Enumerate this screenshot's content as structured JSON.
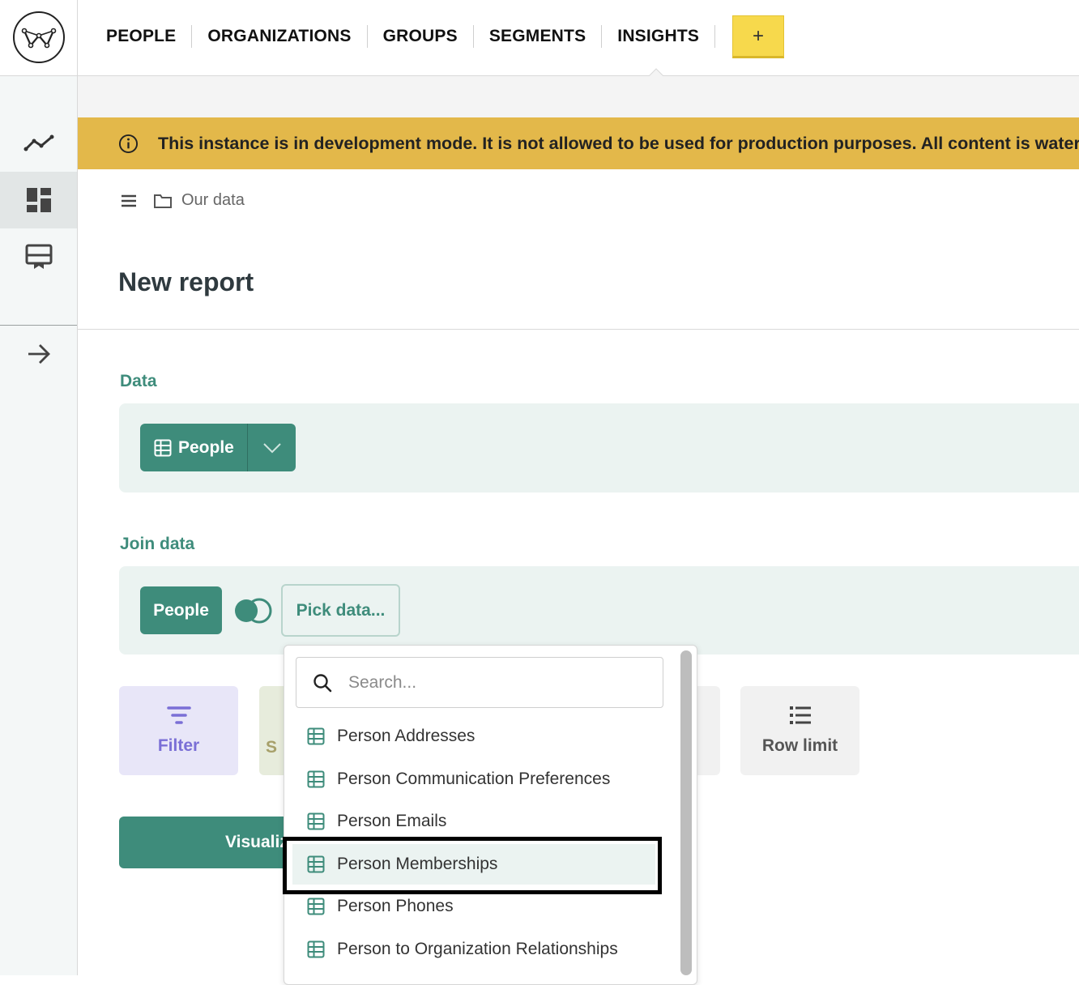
{
  "nav": {
    "items": [
      "PEOPLE",
      "ORGANIZATIONS",
      "GROUPS",
      "SEGMENTS",
      "INSIGHTS"
    ],
    "add_label": "+"
  },
  "rail": {
    "icons": [
      "trend-icon",
      "dashboard-icon",
      "report-icon",
      "arrow-right-icon"
    ],
    "active": "dashboard-icon"
  },
  "banner": {
    "text": "This instance is in development mode. It is not allowed to be used for production purposes. All content is watermark",
    "color": "#e3b84a"
  },
  "breadcrumb": {
    "label": "Our data"
  },
  "page": {
    "title": "New report"
  },
  "data_section": {
    "label": "Data",
    "source_label": "People"
  },
  "join_section": {
    "label": "Join data",
    "left_label": "People",
    "pick_label": "Pick data..."
  },
  "tiles": {
    "filter_label": "Filter",
    "second_partial": "S",
    "row_limit_label": "Row limit"
  },
  "visualize": {
    "label": "Visualiz"
  },
  "dropdown": {
    "search_placeholder": "Search...",
    "options": [
      "Person Addresses",
      "Person Communication Preferences",
      "Person Emails",
      "Person Memberships",
      "Person Phones",
      "Person to Organization Relationships"
    ],
    "highlighted_index": 3
  },
  "colors": {
    "accent": "#3e8c7b",
    "panel": "#ebf3f1",
    "add_button": "#f7d94c"
  }
}
